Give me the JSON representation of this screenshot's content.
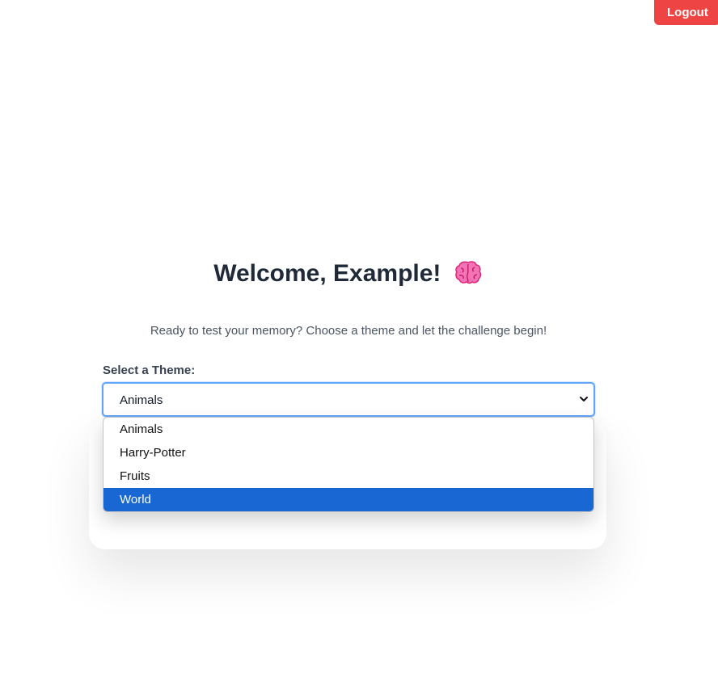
{
  "header": {
    "logout_label": "Logout"
  },
  "welcome": {
    "title": "Welcome, Example!",
    "subtitle": "Ready to test your memory? Choose a theme and let the challenge begin!"
  },
  "theme_select": {
    "label": "Select a Theme:",
    "current_value": "Animals",
    "options": [
      "Animals",
      "Harry-Potter",
      "Fruits",
      "World"
    ],
    "highlighted_option": "World"
  },
  "colors": {
    "logout_bg": "#ef4444",
    "focus_border": "#60a5fa",
    "highlight_bg": "#1967d2",
    "title_text": "#1f2937"
  },
  "icons": {
    "title_icon": "brain-icon",
    "select_icon": "chevron-down-icon"
  }
}
